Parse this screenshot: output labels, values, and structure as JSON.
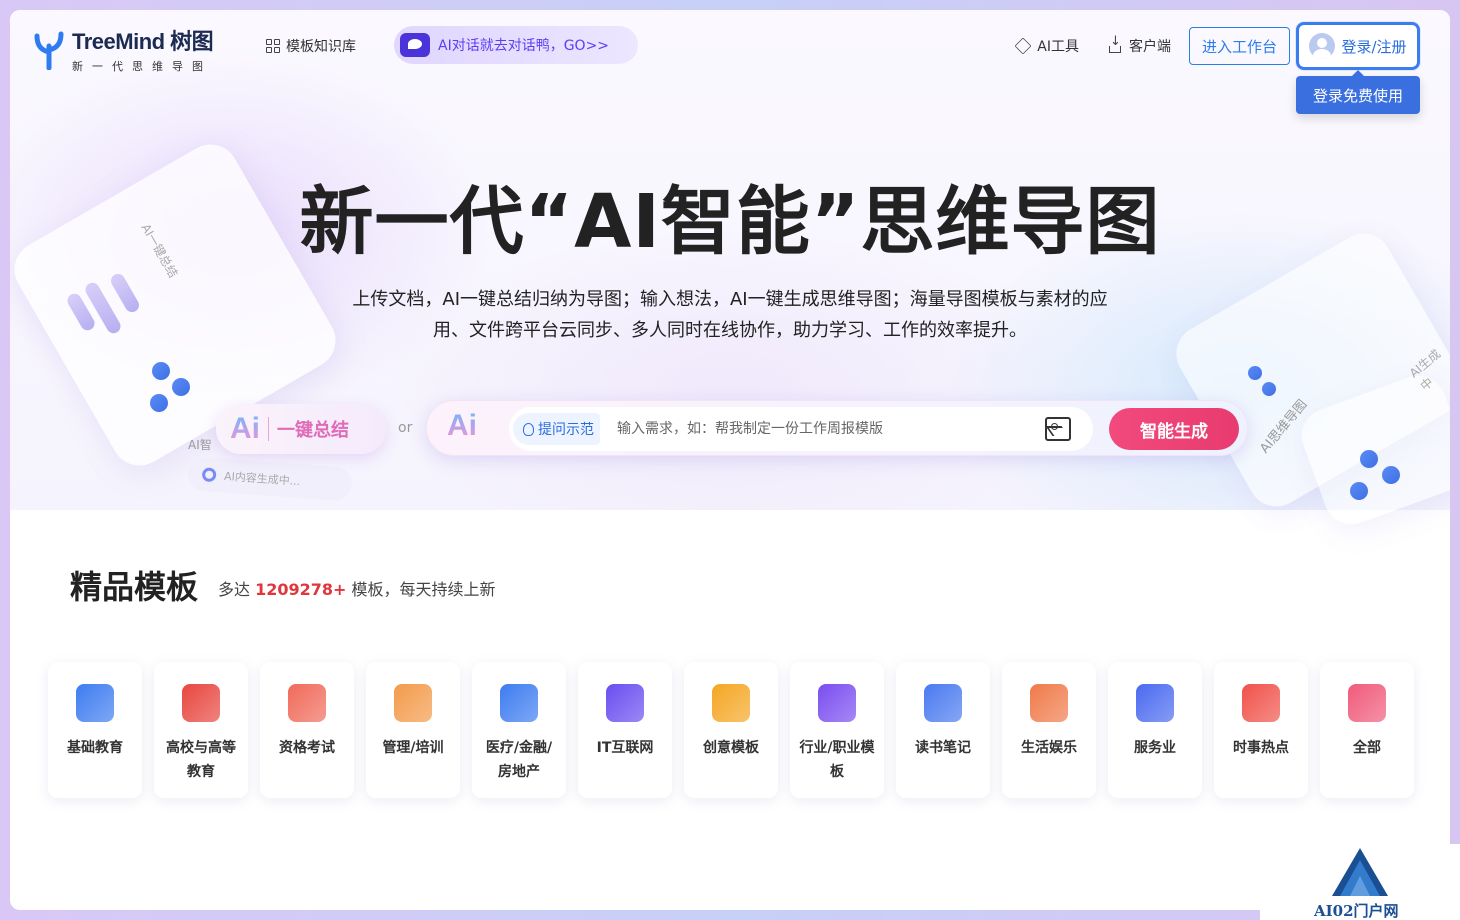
{
  "logo": {
    "title": "TreeMind 树图",
    "subtitle": "新一代思维导图"
  },
  "nav": {
    "templates_label": "模板知识库",
    "ai_chat_label": "AI对话就去对话鸭，GO>>",
    "ai_tools_label": "AI工具",
    "client_label": "客户端",
    "workspace_label": "进入工作台",
    "login_label": "登录/注册",
    "login_tooltip": "登录免费使用"
  },
  "hero": {
    "headline": "新一代“AI智能”思维导图",
    "desc_line1": "上传文档，AI一键总结归纳为导图；输入想法，AI一键生成思维导图；海量导图模板与素材的应",
    "desc_line2": "用、文件跨平台云同步、多人同时在线协作，助力学习、工作的效率提升。",
    "summary_ai": "Ai",
    "summary_label": "一键总结",
    "or_label": "or",
    "search_ai": "Ai",
    "tip_label": "提问示范",
    "search_placeholder": "输入需求，如：帮我制定一份工作周报模版",
    "generate_label": "智能生成",
    "deco_text1": "AI一键总结",
    "deco_text2": "AI内容生成中...",
    "deco_text3": "AI思维导图",
    "deco_text4": "AI生成中",
    "deco_text5": "AI智"
  },
  "templates": {
    "title": "精品模板",
    "sub_prefix": "多达 ",
    "count": "1209278+",
    "sub_suffix": " 模板，每天持续上新",
    "categories": [
      {
        "label": "基础教育",
        "color": "#3d7cf0"
      },
      {
        "label": "高校与高等教育",
        "color": "#e8463f"
      },
      {
        "label": "资格考试",
        "color": "#f06a5a"
      },
      {
        "label": "管理/培训",
        "color": "#f39a4a"
      },
      {
        "label": "医疗/金融/房地产",
        "color": "#3d7cf0"
      },
      {
        "label": "IT互联网",
        "color": "#6a4df0"
      },
      {
        "label": "创意模板",
        "color": "#f5a623"
      },
      {
        "label": "行业/职业模板",
        "color": "#7a4df0"
      },
      {
        "label": "读书笔记",
        "color": "#4a7af0"
      },
      {
        "label": "生活娱乐",
        "color": "#f07a4a"
      },
      {
        "label": "服务业",
        "color": "#4a6af0"
      },
      {
        "label": "时事热点",
        "color": "#f0524a"
      },
      {
        "label": "全部",
        "color": "#f05a7a"
      }
    ]
  },
  "watermark": {
    "text": "AI02门户网"
  }
}
